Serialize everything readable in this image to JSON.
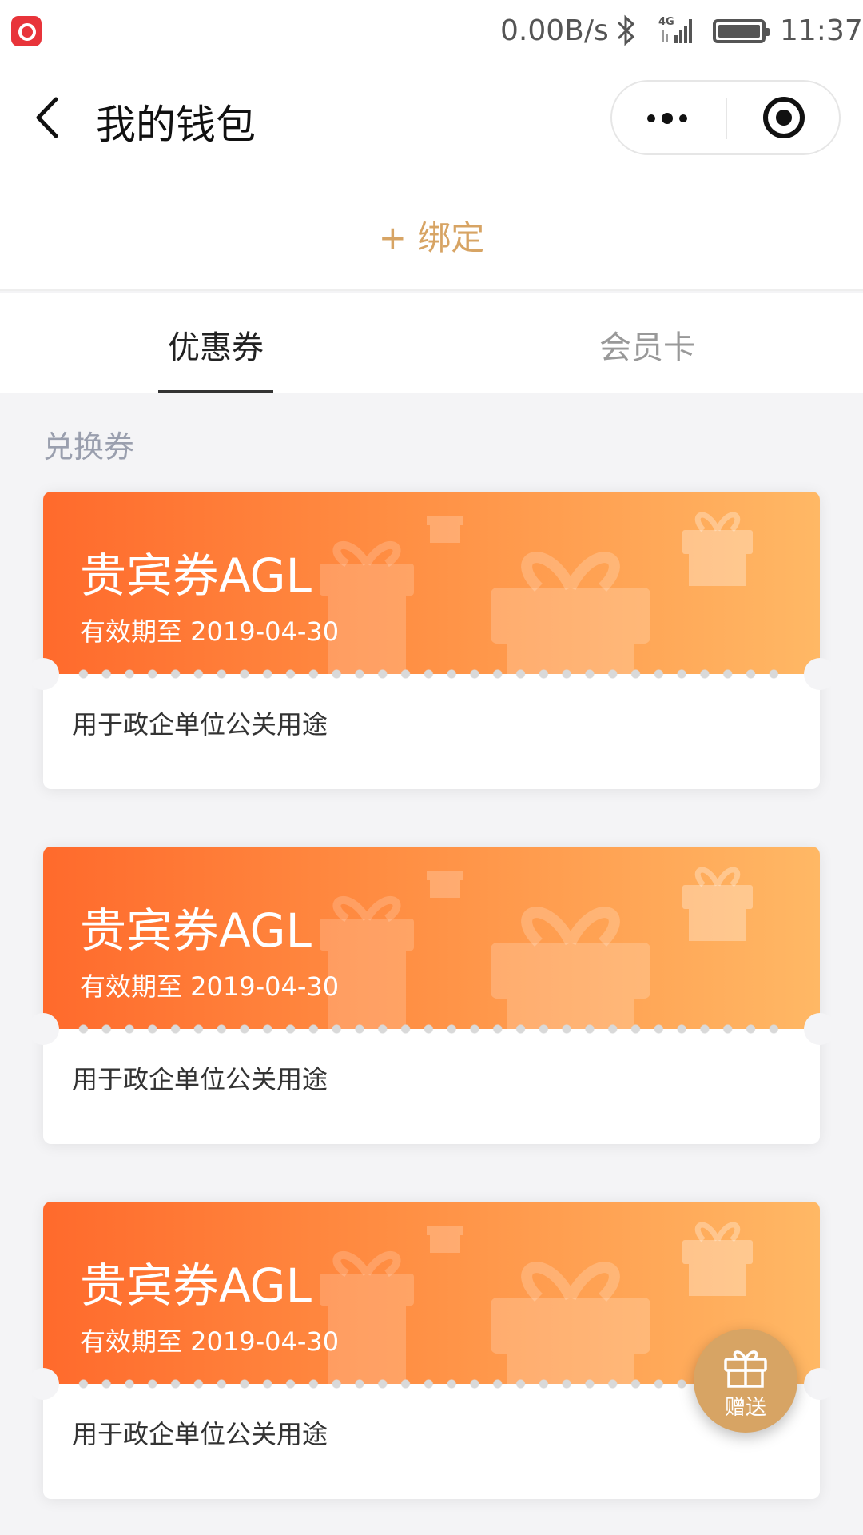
{
  "status_bar": {
    "network_speed": "0.00B/s",
    "signal_label": "4G",
    "time": "11:37",
    "app_icon": "netease-music-icon",
    "bluetooth_icon": "bluetooth-icon",
    "battery_icon": "battery-icon"
  },
  "nav": {
    "title": "我的钱包",
    "back_icon": "chevron-left-icon",
    "more_icon": "more-dots-icon",
    "close_icon": "record-circle-icon"
  },
  "bind": {
    "label": "+ 绑定"
  },
  "tabs": [
    {
      "label": "优惠券",
      "active": true
    },
    {
      "label": "会员卡",
      "active": false
    }
  ],
  "section": {
    "label": "兑换券"
  },
  "coupons": [
    {
      "title": "贵宾券AGL",
      "expiry": "有效期至 2019-04-30",
      "description": "用于政企单位公关用途"
    },
    {
      "title": "贵宾券AGL",
      "expiry": "有效期至 2019-04-30",
      "description": "用于政企单位公关用途"
    },
    {
      "title": "贵宾券AGL",
      "expiry": "有效期至 2019-04-30",
      "description": "用于政企单位公关用途"
    }
  ],
  "gift_button": {
    "label": "赠送",
    "icon": "gift-icon"
  },
  "colors": {
    "accent_gold": "#d7a464",
    "coupon_gradient_start": "#ff6a2c",
    "coupon_gradient_end": "#ffb865",
    "page_background": "#f4f4f6"
  }
}
